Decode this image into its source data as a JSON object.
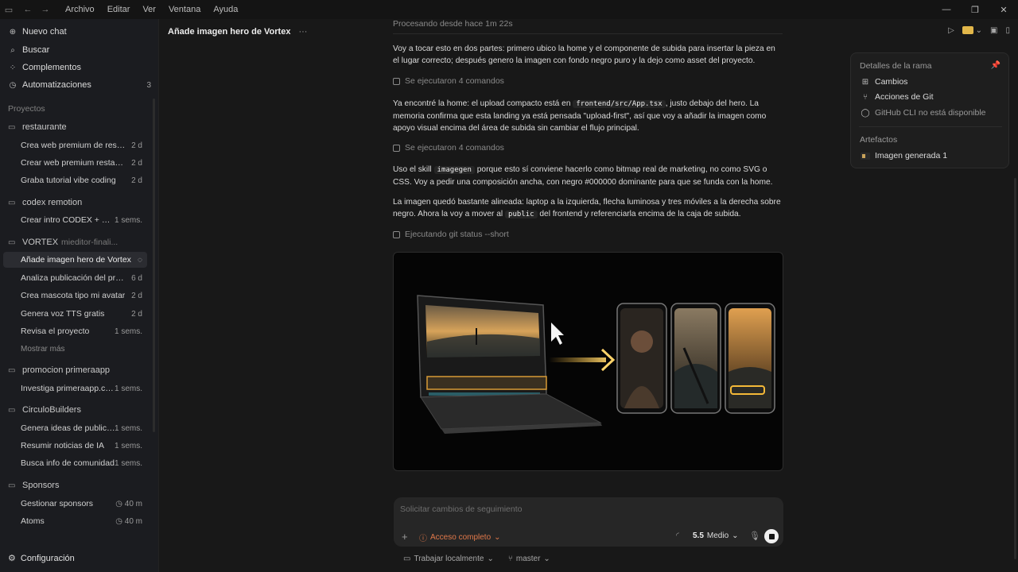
{
  "menubar": {
    "items": [
      "Archivo",
      "Editar",
      "Ver",
      "Ventana",
      "Ayuda"
    ]
  },
  "sidebar": {
    "nav": [
      {
        "label": "Nuevo chat",
        "icon": "new-chat-icon"
      },
      {
        "label": "Buscar",
        "icon": "search-icon"
      },
      {
        "label": "Complementos",
        "icon": "grid-icon"
      },
      {
        "label": "Automatizaciones",
        "icon": "clock-icon",
        "badge": "3"
      }
    ],
    "projects_label": "Proyectos",
    "projects": [
      {
        "name": "restaurante",
        "sub": "",
        "chats": [
          {
            "title": "Crea web premium de restaurante",
            "time": "2 d"
          },
          {
            "title": "Crear web premium restaurante",
            "time": "2 d"
          },
          {
            "title": "Graba tutorial vibe coding",
            "time": "2 d"
          }
        ]
      },
      {
        "name": "codex remotion",
        "sub": "",
        "chats": [
          {
            "title": "Crear intro CODEX + Remotion",
            "time": "1 sems."
          }
        ]
      },
      {
        "name": "VORTEX",
        "sub": "mieditor-finali...",
        "chats": [
          {
            "title": "Añade imagen hero de Vortex",
            "time": "",
            "active": true
          },
          {
            "title": "Analiza publicación del proyecto",
            "time": "6 d"
          },
          {
            "title": "Crea mascota tipo mi avatar",
            "time": "2 d"
          },
          {
            "title": "Genera voz TTS gratis",
            "time": "2 d"
          },
          {
            "title": "Revisa el proyecto",
            "time": "1 sems."
          }
        ],
        "more": "Mostrar más"
      },
      {
        "name": "promocion primeraapp",
        "sub": "",
        "chats": [
          {
            "title": "Investiga primeraapp.com",
            "time": "1 sems."
          }
        ]
      },
      {
        "name": "CirculoBuilders",
        "sub": "",
        "chats": [
          {
            "title": "Genera ideas de publicaciones",
            "time": "1 sems."
          },
          {
            "title": "Resumir noticias de IA",
            "time": "1 sems."
          },
          {
            "title": "Busca info de comunidad",
            "time": "1 sems."
          }
        ]
      },
      {
        "name": "Sponsors",
        "sub": "",
        "chats": [
          {
            "title": "Gestionar sponsors",
            "time": "40 m"
          },
          {
            "title": "Atoms",
            "time": "40 m"
          }
        ]
      }
    ],
    "settings": "Configuración"
  },
  "main": {
    "chat_title": "Añade imagen hero de Vortex",
    "processing": "Procesando desde hace 1m 22s",
    "p1": "Voy a tocar esto en dos partes: primero ubico la home y el componente de subida para insertar la pieza en el lugar correcto; después genero la imagen con fondo negro puro y la dejo como asset del proyecto.",
    "cmd1": "Se ejecutaron 4 comandos",
    "p2_a": "Ya encontré la home: el upload compacto está en",
    "p2_code": "frontend/src/App.tsx",
    "p2_b": ", justo debajo del hero. La memoria confirma que esta landing ya está pensada \"upload-first\", así que voy a añadir la imagen como apoyo visual encima del área de subida sin cambiar el flujo principal.",
    "cmd2": "Se ejecutaron 4 comandos",
    "p3_a": "Uso el skill",
    "p3_code": "imagegen",
    "p3_b": "porque esto sí conviene hacerlo como bitmap real de marketing, no como SVG o CSS. Voy a pedir una composición ancha, con negro #000000 dominante para que se funda con la home.",
    "p4_a": "La imagen quedó bastante alineada: laptop a la izquierda, flecha luminosa y tres móviles a la derecha sobre negro. Ahora la voy a mover al",
    "p4_code": "public",
    "p4_b": "del frontend y referenciarla encima de la caja de subida.",
    "cmd3": "Ejecutando git status --short"
  },
  "right_panel": {
    "header": "Detalles de la rama",
    "rows": [
      "Cambios",
      "Acciones de Git",
      "GitHub CLI no está disponible"
    ],
    "artifacts_label": "Artefactos",
    "artifact": "Imagen generada 1"
  },
  "composer": {
    "placeholder": "Solicitar cambios de seguimiento",
    "access": "Acceso completo",
    "model_num": "5.5",
    "model_mode": "Medio",
    "local": "Trabajar localmente",
    "branch": "master"
  },
  "colors": {
    "accent_orange": "#e0784a",
    "folder_yellow": "#e2b74a",
    "glow_gold": "#f5b938"
  }
}
